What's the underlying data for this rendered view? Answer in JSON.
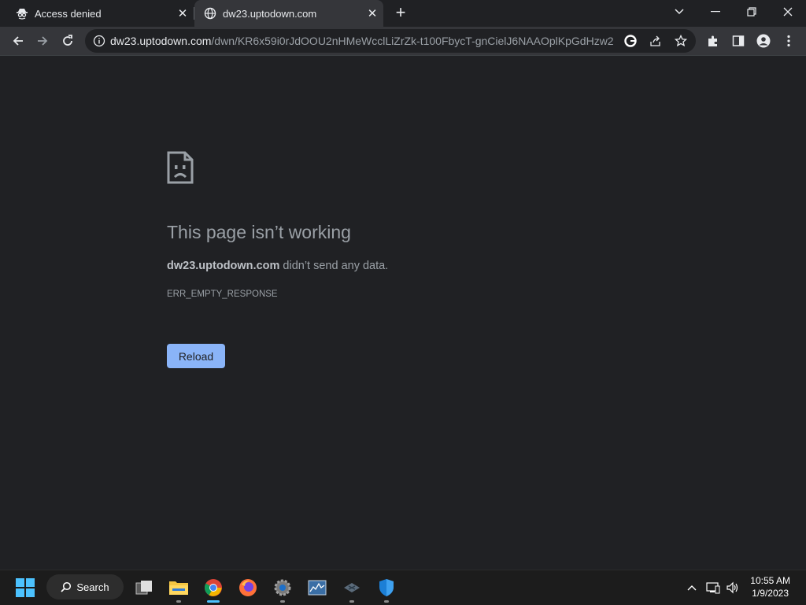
{
  "browser": {
    "tabs": [
      {
        "title": "Access denied",
        "favicon": "spy-icon",
        "active": false
      },
      {
        "title": "dw23.uptodown.com",
        "favicon": "globe-icon",
        "active": true
      }
    ],
    "address": {
      "host": "dw23.uptodown.com",
      "path": "/dwn/KR6x59i0rJdOOU2nHMeWcclLiZrZk-t100FbycT-gnCielJ6NAAOplKpGdHzw2..."
    }
  },
  "error_page": {
    "title": "This page isn’t working",
    "host": "dw23.uptodown.com",
    "message": " didn’t send any data.",
    "code": "ERR_EMPTY_RESPONSE",
    "reload_label": "Reload"
  },
  "taskbar": {
    "search_label": "Search",
    "time": "10:55 AM",
    "date": "1/9/2023"
  },
  "colors": {
    "page_bg": "#202124",
    "toolbar_bg": "#35363a",
    "accent": "#8ab4f8",
    "taskbar_bg": "#1c1c1c",
    "active_indicator": "#4cc2ff"
  }
}
